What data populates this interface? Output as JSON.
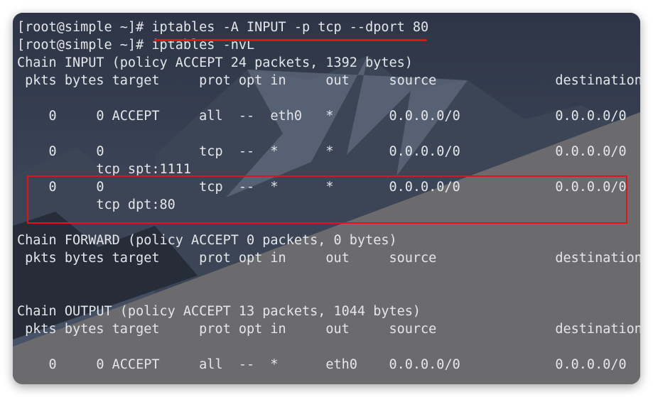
{
  "colors": {
    "sky_top": "#2d3546",
    "sky_bottom": "#4a566a",
    "mountain_dark": "#262c38",
    "mountain_mid": "#3b4555",
    "mountain_light": "#6e7a8c",
    "slope_grey": "#6b6b6d",
    "terminal_text": "#e4e6ea",
    "highlight_red": "#e0141b"
  },
  "terminal": {
    "lines": [
      "[root@simple ~]# iptables -A INPUT -p tcp --dport 80",
      "[root@simple ~]# iptables -nvL",
      "Chain INPUT (policy ACCEPT 24 packets, 1392 bytes)",
      " pkts bytes target     prot opt in     out     source               destination",
      "",
      "    0     0 ACCEPT     all  --  eth0   *       0.0.0.0/0            0.0.0.0/0",
      "",
      "    0     0            tcp  --  *      *       0.0.0.0/0            0.0.0.0/0",
      "          tcp spt:1111",
      "    0     0            tcp  --  *      *       0.0.0.0/0            0.0.0.0/0",
      "          tcp dpt:80",
      "",
      "Chain FORWARD (policy ACCEPT 0 packets, 0 bytes)",
      " pkts bytes target     prot opt in     out     source               destination",
      "",
      "",
      "Chain OUTPUT (policy ACCEPT 13 packets, 1044 bytes)",
      " pkts bytes target     prot opt in     out     source               destination",
      "",
      "    0     0 ACCEPT     all  --  *      eth0    0.0.0.0/0            0.0.0.0/0"
    ]
  }
}
